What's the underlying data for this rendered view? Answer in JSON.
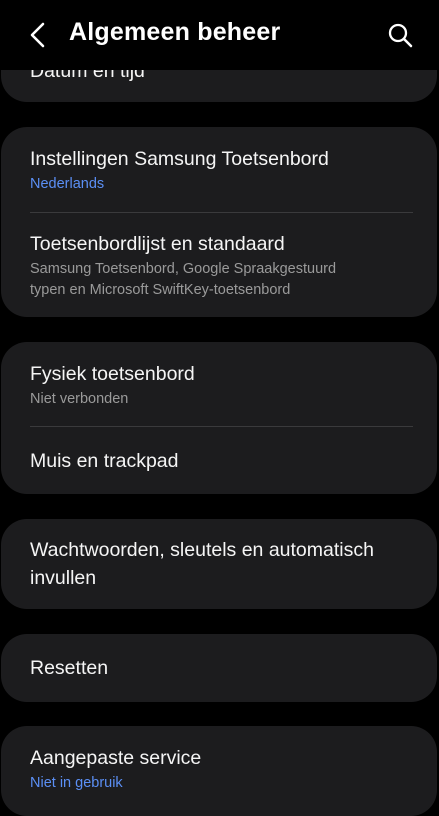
{
  "header": {
    "title": "Algemeen beheer",
    "back_icon": "chevron-left-icon",
    "search_icon": "search-icon"
  },
  "colors": {
    "background": "#000000",
    "card": "#1c1c1e",
    "accent": "#5b8ff5",
    "secondary_text": "#9a9a9a"
  },
  "cards": {
    "date_time": {
      "title": "Datum en tijd"
    },
    "keyboard": {
      "samsung_keyboard": {
        "title": "Instellingen Samsung Toetsenbord",
        "subtitle": "Nederlands"
      },
      "keyboard_list": {
        "title": "Toetsenbordlijst en standaard",
        "subtitle_line1": "Samsung Toetsenbord, Google Spraakgestuurd",
        "subtitle_line2": "typen en Microsoft SwiftKey-toetsenbord"
      }
    },
    "physical": {
      "physical_keyboard": {
        "title": "Fysiek toetsenbord",
        "subtitle": "Niet verbonden"
      },
      "mouse_trackpad": {
        "title": "Muis en trackpad"
      }
    },
    "passwords": {
      "title_line1": "Wachtwoorden, sleutels en automatisch",
      "title_line2": "invullen"
    },
    "reset": {
      "title": "Resetten"
    },
    "custom_service": {
      "title": "Aangepaste service",
      "subtitle": "Niet in gebruik"
    }
  }
}
